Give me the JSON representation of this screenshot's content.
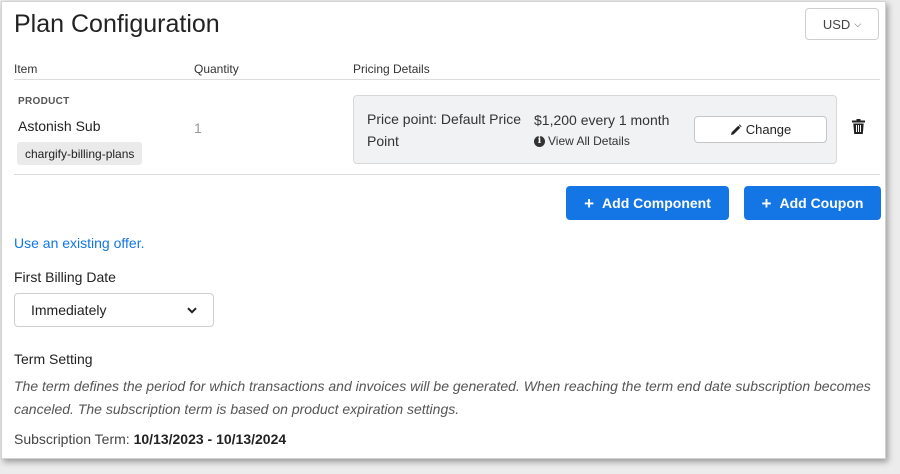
{
  "header": {
    "title": "Plan Configuration",
    "currency": "USD"
  },
  "columns": {
    "item": "Item",
    "quantity": "Quantity",
    "pricing": "Pricing Details"
  },
  "product": {
    "label": "PRODUCT",
    "name": "Astonish Sub",
    "tag": "chargify-billing-plans",
    "quantity": "1"
  },
  "pricing": {
    "price_point": "Price point: Default Price Point",
    "amount": "$1,200 every 1 month",
    "view_details": "View All Details",
    "change_label": "Change"
  },
  "actions": {
    "add_component": "Add Component",
    "add_coupon": "Add Coupon"
  },
  "existing_offer_link": "Use an existing offer.",
  "billing": {
    "label": "First Billing Date",
    "selected": "Immediately"
  },
  "term": {
    "heading": "Term Setting",
    "description": "The term defines the period for which transactions and invoices will be generated. When reaching the term end date subscription becomes canceled. The subscription term is based on product expiration settings.",
    "subscription_label": "Subscription Term:",
    "subscription_value": "10/13/2023 - 10/13/2024"
  },
  "colors": {
    "accent": "#1476e4",
    "panel": "#f1f2f3"
  }
}
